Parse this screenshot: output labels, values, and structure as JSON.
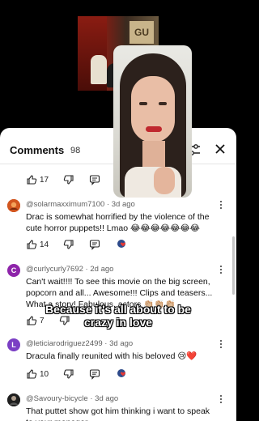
{
  "header": {
    "title": "Comments",
    "count": "98"
  },
  "caption": {
    "line1": "Because it's all about to be",
    "line2": "crazy in love"
  },
  "first_actions": {
    "likes": "17"
  },
  "comments": [
    {
      "author": "@solarmaxximum7100",
      "time": "3d ago",
      "text": "Drac is somewhat horrified by the violence of the cute horror puppets!! Lmao 😂😂😂😂😂😂😂",
      "likes": "14",
      "avatar_color": "#c0451a"
    },
    {
      "author": "@curlycurly7692",
      "time": "2d ago",
      "text": "Can't wait!!!! To see this movie on the big screen, popcorn and all... Awesome!!! Clips and teasers... What a story! Fabulous, actors 👏🏼👏🏼👏🏼",
      "likes": "7",
      "avatar_letter": "C",
      "avatar_color": "#8e24aa"
    },
    {
      "author": "@leticiarodriguez2499",
      "time": "3d ago",
      "text": "Dracula finally reunited with his beloved 😢❤️",
      "likes": "10",
      "avatar_letter": "L",
      "avatar_color": "#7b3fc4"
    },
    {
      "author": "@Savoury-bicycle",
      "time": "3d ago",
      "text": "That puttet show got him thinking i want to speak to your manager",
      "avatar_color": "#2b2b2b"
    }
  ],
  "colors": {
    "sheet_bg": "#ffffff",
    "text": "#0f0f0f",
    "meta": "#606060"
  }
}
